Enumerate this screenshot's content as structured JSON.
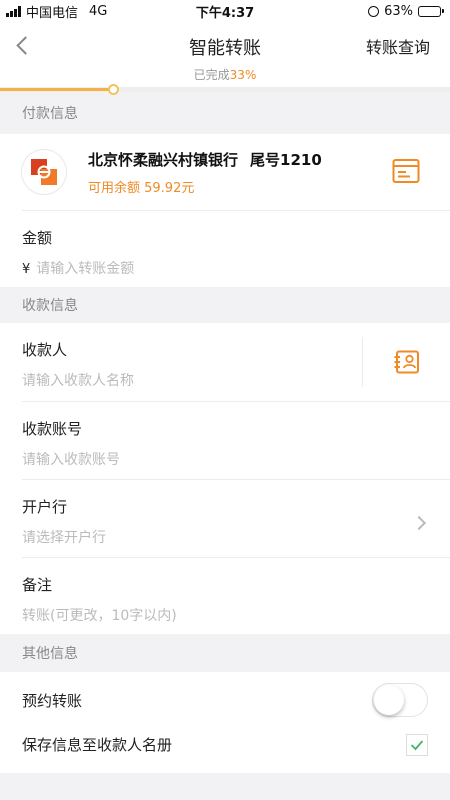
{
  "status_bar": {
    "carrier": "中国电信",
    "network": "4G",
    "time": "下午4:37",
    "battery_percent": "63%",
    "battery_level": 0.63
  },
  "nav": {
    "title": "智能转账",
    "right_action": "转账查询",
    "progress_label": "已完成",
    "progress_value": "33%",
    "progress_fraction": 0.25
  },
  "payer_section": {
    "header": "付款信息",
    "bank_name": "北京怀柔融兴村镇银行",
    "tail_label": "尾号1210",
    "balance": "可用余额 59.92元"
  },
  "amount": {
    "label": "金额",
    "currency_symbol": "¥",
    "placeholder": "请输入转账金额"
  },
  "payee_section": {
    "header": "收款信息",
    "payee_label": "收款人",
    "payee_placeholder": "请输入收款人名称",
    "account_label": "收款账号",
    "account_placeholder": "请输入收款账号",
    "bank_label": "开户行",
    "bank_placeholder": "请选择开户行",
    "memo_label": "备注",
    "memo_placeholder": "转账(可更改，10字以内)"
  },
  "other_section": {
    "header": "其他信息",
    "schedule_label": "预约转账",
    "schedule_on": false,
    "save_label": "保存信息至收款人名册",
    "save_checked": true
  },
  "icons": {
    "back": "back-chevron-icon",
    "card": "bank-card-icon",
    "contact": "contact-book-icon",
    "chevron": "chevron-right-icon",
    "check": "check-icon"
  },
  "colors": {
    "accent": "#f08a24",
    "progress": "#f5b046",
    "check": "#45b46a"
  }
}
